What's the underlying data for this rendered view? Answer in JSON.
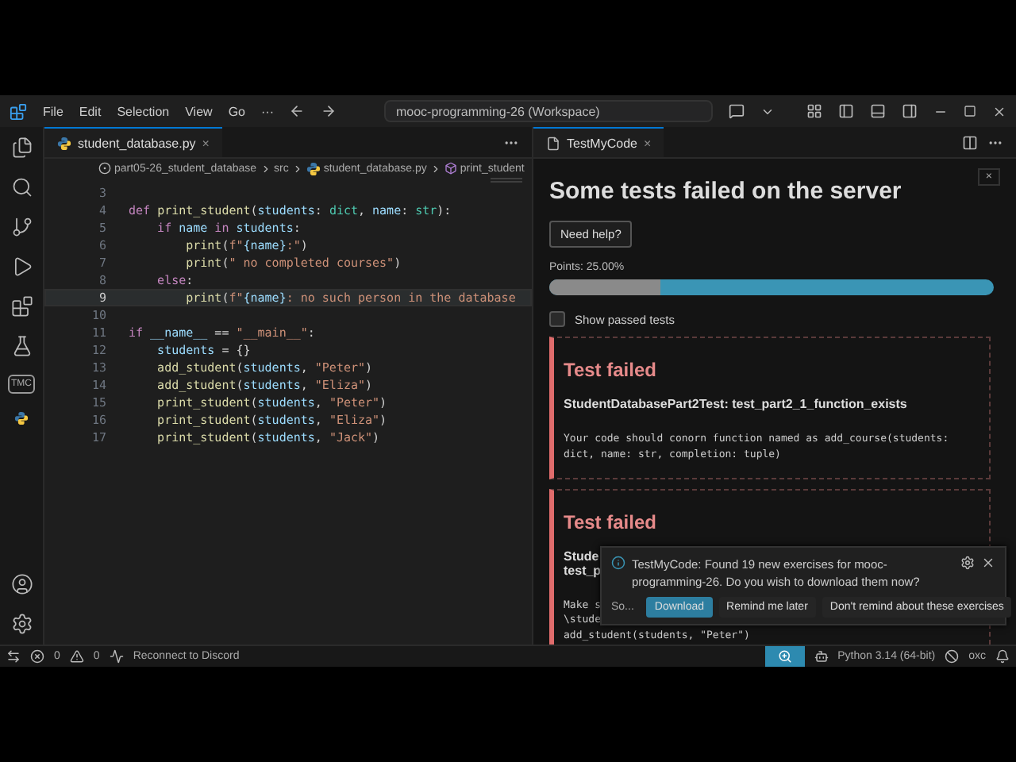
{
  "menu": [
    "File",
    "Edit",
    "Selection",
    "View",
    "Go",
    "···"
  ],
  "command_center": {
    "value": "mooc-programming-26 (Workspace)"
  },
  "activity_bar": {
    "tmc_label": "TMC"
  },
  "editor": {
    "tab": {
      "label": "student_database.py",
      "close": "×"
    },
    "breadcrumb": [
      "part05-26_student_database",
      "src",
      "student_database.py",
      "print_student"
    ],
    "lines": [
      {
        "number": "3",
        "current": false
      },
      {
        "number": "4",
        "current": false,
        "tokens": [
          {
            "kind": "kw",
            "text": "def "
          },
          {
            "kind": "fn",
            "text": "print_student"
          },
          {
            "kind": "punc",
            "text": "("
          },
          {
            "kind": "var",
            "text": "students"
          },
          {
            "kind": "punc",
            "text": ": "
          },
          {
            "kind": "type",
            "text": "dict"
          },
          {
            "kind": "punc",
            "text": ", "
          },
          {
            "kind": "var",
            "text": "name"
          },
          {
            "kind": "punc",
            "text": ": "
          },
          {
            "kind": "type",
            "text": "str"
          },
          {
            "kind": "punc",
            "text": "):"
          }
        ]
      },
      {
        "number": "5",
        "current": false,
        "tokens": [
          {
            "kind": "kw",
            "text": "    if "
          },
          {
            "kind": "var",
            "text": "name"
          },
          {
            "kind": "kw",
            "text": " in "
          },
          {
            "kind": "var",
            "text": "students"
          },
          {
            "kind": "punc",
            "text": ":"
          }
        ]
      },
      {
        "number": "6",
        "current": false,
        "tokens": [
          {
            "kind": "fn",
            "text": "        print"
          },
          {
            "kind": "punc",
            "text": "("
          },
          {
            "kind": "str",
            "text": "f\""
          },
          {
            "kind": "var",
            "text": "{name}"
          },
          {
            "kind": "str",
            "text": ":\""
          },
          {
            "kind": "punc",
            "text": ")"
          }
        ]
      },
      {
        "number": "7",
        "current": false,
        "tokens": [
          {
            "kind": "fn",
            "text": "        print"
          },
          {
            "kind": "punc",
            "text": "("
          },
          {
            "kind": "str",
            "text": "\" no completed courses\""
          },
          {
            "kind": "punc",
            "text": ")"
          }
        ]
      },
      {
        "number": "8",
        "current": false,
        "tokens": [
          {
            "kind": "kw",
            "text": "    else"
          },
          {
            "kind": "punc",
            "text": ":"
          }
        ]
      },
      {
        "number": "9",
        "current": true,
        "tokens": [
          {
            "kind": "fn",
            "text": "        print"
          },
          {
            "kind": "punc",
            "text": "("
          },
          {
            "kind": "str",
            "text": "f\""
          },
          {
            "kind": "var",
            "text": "{name}"
          },
          {
            "kind": "str",
            "text": ": no such person in the database"
          }
        ]
      },
      {
        "number": "10",
        "current": false
      },
      {
        "number": "11",
        "current": false,
        "tokens": [
          {
            "kind": "kw",
            "text": "if "
          },
          {
            "kind": "var",
            "text": "__name__"
          },
          {
            "kind": "punc",
            "text": " == "
          },
          {
            "kind": "str",
            "text": "\"__main__\""
          },
          {
            "kind": "punc",
            "text": ":"
          }
        ]
      },
      {
        "number": "12",
        "current": false,
        "tokens": [
          {
            "kind": "var",
            "text": "    students"
          },
          {
            "kind": "punc",
            "text": " = {}"
          }
        ]
      },
      {
        "number": "13",
        "current": false,
        "tokens": [
          {
            "kind": "fn",
            "text": "    add_student"
          },
          {
            "kind": "punc",
            "text": "("
          },
          {
            "kind": "var",
            "text": "students"
          },
          {
            "kind": "punc",
            "text": ", "
          },
          {
            "kind": "str",
            "text": "\"Peter\""
          },
          {
            "kind": "punc",
            "text": ")"
          }
        ]
      },
      {
        "number": "14",
        "current": false,
        "tokens": [
          {
            "kind": "fn",
            "text": "    add_student"
          },
          {
            "kind": "punc",
            "text": "("
          },
          {
            "kind": "var",
            "text": "students"
          },
          {
            "kind": "punc",
            "text": ", "
          },
          {
            "kind": "str",
            "text": "\"Eliza\""
          },
          {
            "kind": "punc",
            "text": ")"
          }
        ]
      },
      {
        "number": "15",
        "current": false,
        "tokens": [
          {
            "kind": "fn",
            "text": "    print_student"
          },
          {
            "kind": "punc",
            "text": "("
          },
          {
            "kind": "var",
            "text": "students"
          },
          {
            "kind": "punc",
            "text": ", "
          },
          {
            "kind": "str",
            "text": "\"Peter\""
          },
          {
            "kind": "punc",
            "text": ")"
          }
        ]
      },
      {
        "number": "16",
        "current": false,
        "tokens": [
          {
            "kind": "fn",
            "text": "    print_student"
          },
          {
            "kind": "punc",
            "text": "("
          },
          {
            "kind": "var",
            "text": "students"
          },
          {
            "kind": "punc",
            "text": ", "
          },
          {
            "kind": "str",
            "text": "\"Eliza\""
          },
          {
            "kind": "punc",
            "text": ")"
          }
        ]
      },
      {
        "number": "17",
        "current": false,
        "tokens": [
          {
            "kind": "fn",
            "text": "    print_student"
          },
          {
            "kind": "punc",
            "text": "("
          },
          {
            "kind": "var",
            "text": "students"
          },
          {
            "kind": "punc",
            "text": ", "
          },
          {
            "kind": "str",
            "text": "\"Jack\""
          },
          {
            "kind": "punc",
            "text": ")"
          }
        ]
      }
    ]
  },
  "panel": {
    "tab": {
      "label": "TestMyCode",
      "close": "×"
    },
    "close_button": "×",
    "heading": "Some tests failed on the server",
    "help_button": "Need help?",
    "points": "Points: 25.00%",
    "points_bar": {
      "level": 0.25
    },
    "show_passed": {
      "label": "Show passed tests",
      "checked": false
    },
    "results": [
      {
        "title": "Test failed",
        "test_name": "StudentDatabasePart2Test: test_part2_1_function_exists",
        "message": [
          "Your code should conorn function named as add_course(students:",
          "dict, name: str, completion: tuple)"
        ]
      },
      {
        "title": "Test failed",
        "test_name": "Stude\ntest_p",
        "message": [
          "Make s",
          "\\stude",
          "add_student(students, \"Peter\")"
        ]
      }
    ]
  },
  "notification": {
    "text": "TestMyCode: Found 19 new exercises for mooc-programming-26. Do you wish to download them now?",
    "source": "So...",
    "buttons": [
      {
        "label": "Download",
        "primary": true
      },
      {
        "label": "Remind me later",
        "primary": false
      },
      {
        "label": "Don't remind about these exercises",
        "primary": false
      }
    ]
  },
  "status_bar": {
    "errors": "0",
    "warnings": "0",
    "discord": "Reconnect to Discord",
    "interpreter": "Python 3.14 (64-bit)",
    "linter": "oxc"
  }
}
